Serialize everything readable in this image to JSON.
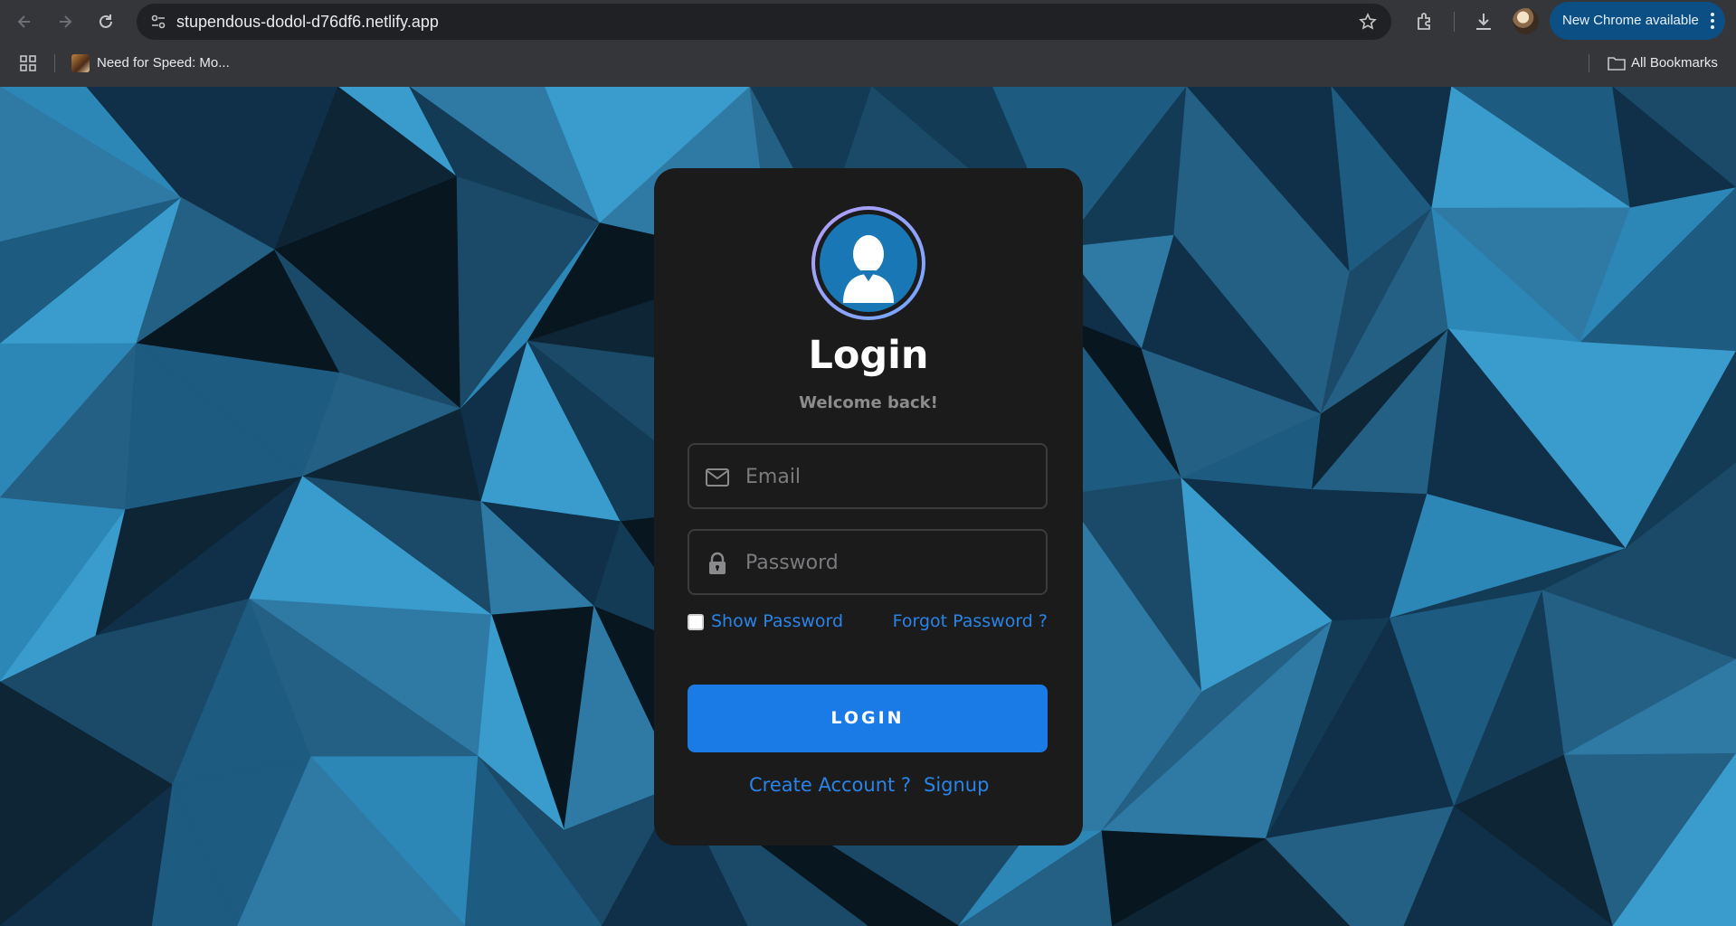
{
  "browser": {
    "url": "stupendous-dodol-d76df6.netlify.app",
    "update_label": "New Chrome available",
    "bookmarks": [
      {
        "label": "Need for Speed: Mo..."
      }
    ],
    "all_bookmarks_label": "All Bookmarks"
  },
  "login": {
    "title": "Login",
    "subtitle": "Welcome back!",
    "email_placeholder": "Email",
    "password_placeholder": "Password",
    "show_password_label": "Show Password",
    "forgot_password_label": "Forgot Password ?",
    "submit_label": "LOGIN",
    "create_account_label": "Create Account ?",
    "signup_label": "Signup"
  },
  "colors": {
    "accent": "#1a7ae6",
    "link": "#2a84e8",
    "card_bg": "#1b1b1c",
    "update_button_bg": "#0b4f84"
  },
  "icons": [
    "back-icon",
    "forward-icon",
    "reload-icon",
    "site-info-icon",
    "bookmark-star-icon",
    "extensions-icon",
    "downloads-icon",
    "apps-grid-icon",
    "folder-icon",
    "user-icon",
    "mail-icon",
    "lock-icon"
  ]
}
